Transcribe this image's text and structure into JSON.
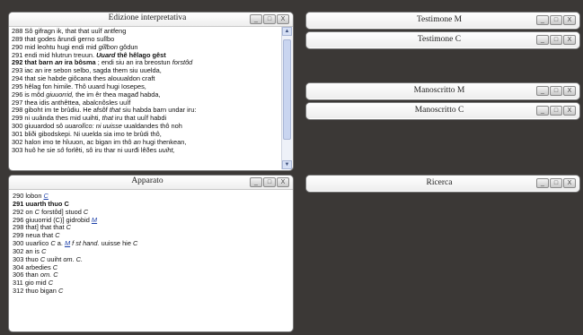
{
  "panels": {
    "edizione": {
      "title": "Edizione interpretativa"
    },
    "apparato": {
      "title": "Apparato"
    },
    "testimone_m": {
      "title": "Testimone M"
    },
    "testimone_c": {
      "title": "Testimone C"
    },
    "manoscritto_m": {
      "title": "Manoscritto M"
    },
    "manoscritto_c": {
      "title": "Manoscritto C"
    },
    "ricerca": {
      "title": "Ricerca"
    }
  },
  "window_controls": {
    "minimize": "_",
    "maximize": "□",
    "close": "X"
  },
  "scroll_icons": {
    "up": "▲",
    "down": "▼"
  },
  "edizione_lines": [
    [
      {
        "t": "288                    Sô gifragn ik, that that uuîf antfeng"
      }
    ],
    [
      {
        "t": "289 that godes ârundi   gerno sulĩbo"
      }
    ],
    [
      {
        "t": "290 mid leohtu hugi   endi mid "
      },
      {
        "t": "giĩĩbon",
        "c": "i"
      },
      {
        "t": " gôdun"
      }
    ],
    [
      {
        "t": "291 endi mid hlutrun treuun.   "
      },
      {
        "t": "Uuard",
        "c": "b i"
      },
      {
        "t": " thê hêlago gêst",
        "c": "b"
      }
    ],
    [
      {
        "t": "292 that barn ",
        "c": "b"
      },
      {
        "t": "an",
        "c": "b i"
      },
      {
        "t": " ira bôsma",
        "c": "b"
      },
      {
        "t": " ;   endi siu an ira breostun "
      },
      {
        "t": "forstôd",
        "c": "i"
      }
    ],
    [
      {
        "t": "293 iac an ire sebon selbo,   sagda them siu uuelda,"
      }
    ],
    [
      {
        "t": "294 that sie habde giôcana   thes alouualdon craft"
      }
    ],
    [
      {
        "t": "295 hêlag fon himile.   Thô uuard hugi Iosepes,"
      }
    ],
    [
      {
        "t": "296 is môd "
      },
      {
        "t": "giuuorrid,",
        "c": "i"
      },
      {
        "t": "   the im êr thea magađ habda,"
      }
    ],
    [
      {
        "t": "297 thea idis anthêttea,   abalcnôsles uuîf"
      }
    ],
    [
      {
        "t": "298 giboht im te brûdiu.   He afsôf "
      },
      {
        "t": "that",
        "c": "i"
      },
      {
        "t": " siu habda barn undar iru:"
      }
    ],
    [
      {
        "t": "299 ni uuânda thes mid uuihti,   "
      },
      {
        "t": "that",
        "c": "i"
      },
      {
        "t": " iru that uuîf habdi"
      }
    ],
    [
      {
        "t": "300 giuuardod sô "
      },
      {
        "t": "uuarolîco:",
        "c": "i"
      },
      {
        "t": "   "
      },
      {
        "t": "ni uuisse",
        "c": "i"
      },
      {
        "t": " uualdandes thô noh"
      }
    ],
    [
      {
        "t": "301 bliði gibodskepi.   Ni uuelda sia imo te brûdi thô,"
      }
    ],
    [
      {
        "t": "302 halon imo te hîuuon,   ac bigan im thô "
      },
      {
        "t": "an",
        "c": "i"
      },
      {
        "t": " hugi thenkean,"
      }
    ],
    [
      {
        "t": "303 huô he sie "
      },
      {
        "t": "sô",
        "c": "i"
      },
      {
        "t": " forlêti,   sô iru thar ni uurđi lêðes "
      },
      {
        "t": "uuiht,",
        "c": "i"
      }
    ]
  ],
  "apparato_lines": [
    [
      {
        "t": "290 lobon "
      },
      {
        "t": "C",
        "c": "u"
      }
    ],
    [
      {
        "t": "291 uuarth thuo C",
        "c": "b"
      }
    ],
    [
      {
        "t": "292 on "
      },
      {
        "t": "C",
        "c": "i"
      },
      {
        "t": "  forstôd] stuod "
      },
      {
        "t": "C",
        "c": "i"
      }
    ],
    [
      {
        "t": "296 giuuorrid (C)] gidrobid "
      },
      {
        "t": "M",
        "c": "u"
      }
    ],
    [
      {
        "t": "298 that] that that "
      },
      {
        "t": "C",
        "c": "i"
      }
    ],
    [
      {
        "t": "299 neua that "
      },
      {
        "t": "C",
        "c": "i"
      }
    ],
    [
      {
        "t": "300 uuarlico "
      },
      {
        "t": "C",
        "c": "i"
      },
      {
        "t": " a. "
      },
      {
        "t": "M",
        "c": "u"
      },
      {
        "t": " f st hand.",
        "c": "i"
      },
      {
        "t": "  uuisse hie "
      },
      {
        "t": "C",
        "c": "i"
      }
    ],
    [
      {
        "t": "302 an is "
      },
      {
        "t": "C",
        "c": "i"
      }
    ],
    [
      {
        "t": "303 thuo "
      },
      {
        "t": "C",
        "c": "i"
      },
      {
        "t": "   uuiht "
      },
      {
        "t": "om. C.",
        "c": "i"
      }
    ],
    [
      {
        "t": "304 arbedies "
      },
      {
        "t": "C",
        "c": "i"
      }
    ],
    [
      {
        "t": "306 than "
      },
      {
        "t": "om. C",
        "c": "i"
      }
    ],
    [
      {
        "t": "311 gio mid "
      },
      {
        "t": "C",
        "c": "i"
      }
    ],
    [
      {
        "t": "312 thuo bigan "
      },
      {
        "t": "C",
        "c": "i"
      }
    ]
  ]
}
